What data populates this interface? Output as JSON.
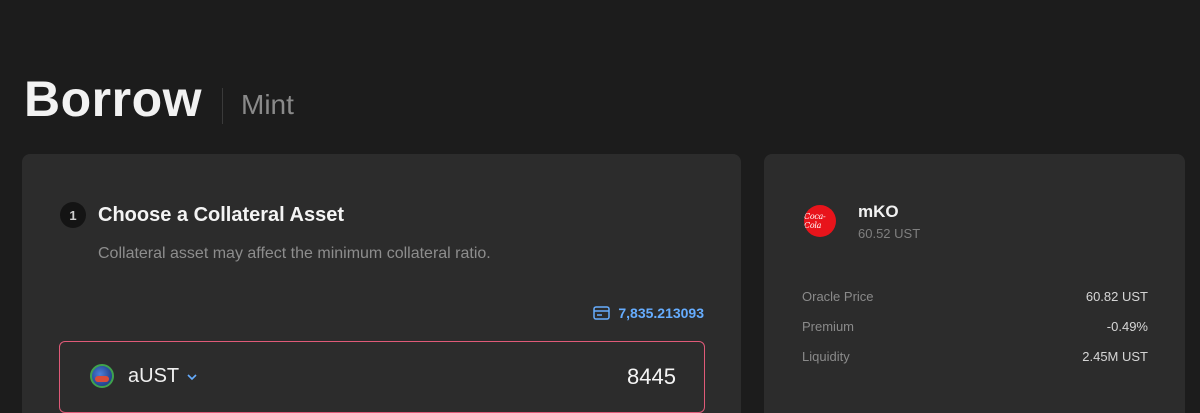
{
  "header": {
    "active_tab": "Borrow",
    "inactive_tab": "Mint"
  },
  "collateral": {
    "step_number": "1",
    "title": "Choose a Collateral Asset",
    "description": "Collateral asset may affect the minimum collateral ratio.",
    "balance": "7,835.213093",
    "asset": "aUST",
    "amount": "8445"
  },
  "token": {
    "symbol": "mKO",
    "price": "60.52 UST",
    "logo_text": "Coca-Cola",
    "stats": [
      {
        "label": "Oracle Price",
        "value": "60.82 UST"
      },
      {
        "label": "Premium",
        "value": "-0.49%"
      },
      {
        "label": "Liquidity",
        "value": "2.45M UST"
      }
    ]
  },
  "colors": {
    "accent_blue": "#66adff",
    "input_border": "#e05a78",
    "card_bg": "#2c2c2c",
    "page_bg": "#1c1c1c"
  },
  "icons": {
    "balance": "wallet-icon",
    "asset": "aust-token-icon",
    "dropdown": "chevron-down-icon",
    "token": "coca-cola-logo-icon"
  }
}
